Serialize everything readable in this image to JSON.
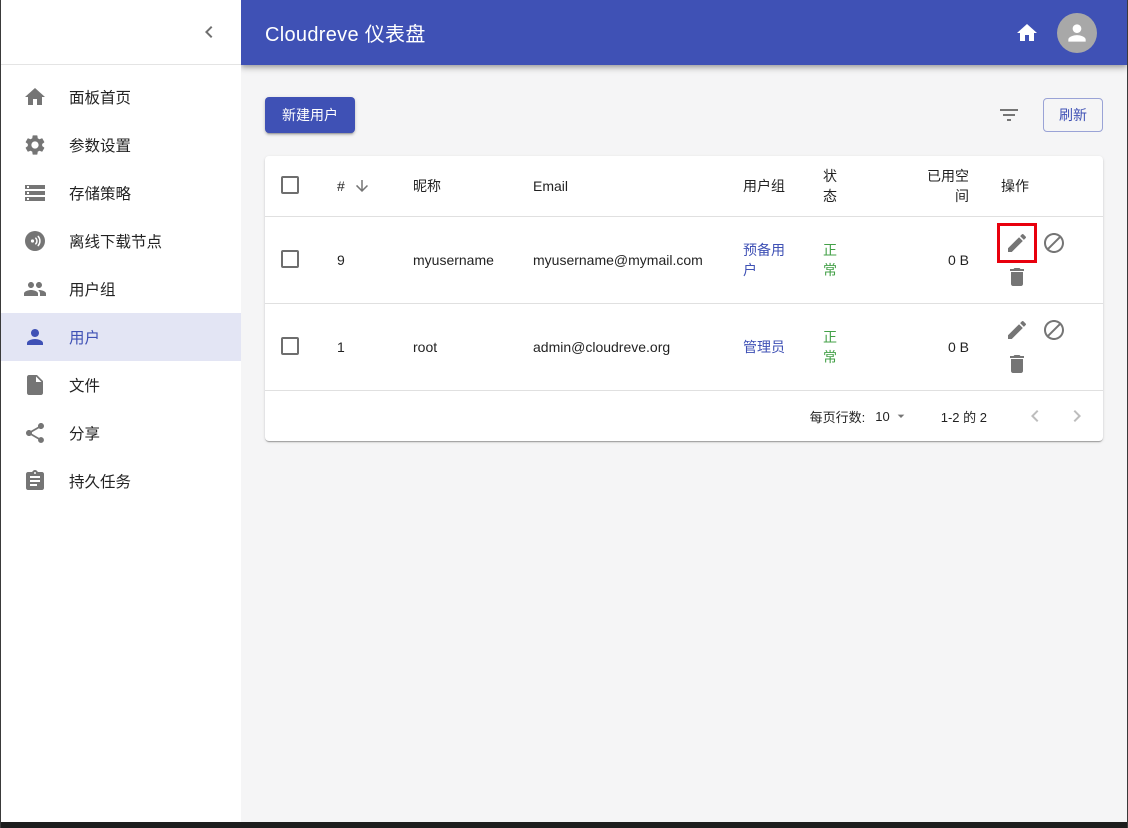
{
  "colors": {
    "primary": "#3f51b5",
    "selected_item_bg": "#e3e5f4",
    "status_ok_green": "#43a047",
    "icon_gray": "#757575",
    "highlight_red": "#e8000d",
    "content_bg": "#f5f5f6"
  },
  "app_bar": {
    "title": "Cloudreve 仪表盘",
    "icons": [
      "home-icon",
      "avatar-person-icon"
    ]
  },
  "sidebar": {
    "collapse_icon": "chevron-left-icon",
    "items": [
      {
        "label": "面板首页",
        "icon": "home-icon",
        "selected": false
      },
      {
        "label": "参数设置",
        "icon": "gear-icon",
        "selected": false
      },
      {
        "label": "存储策略",
        "icon": "storage-icon",
        "selected": false
      },
      {
        "label": "离线下载节点",
        "icon": "broadcast-node-icon",
        "selected": false
      },
      {
        "label": "用户组",
        "icon": "group-icon",
        "selected": false
      },
      {
        "label": "用户",
        "icon": "person-icon",
        "selected": true
      },
      {
        "label": "文件",
        "icon": "file-icon",
        "selected": false
      },
      {
        "label": "分享",
        "icon": "share-icon",
        "selected": false
      },
      {
        "label": "持久任务",
        "icon": "clipboard-icon",
        "selected": false
      }
    ]
  },
  "toolbar": {
    "new_user_label": "新建用户",
    "filter_icon": "filter-list-icon",
    "refresh_label": "刷新"
  },
  "table": {
    "headers": {
      "id": "#",
      "sort_icon": "arrow-down-icon",
      "nick": "昵称",
      "email": "Email",
      "group": "用户组",
      "status": "状态",
      "used": "已用空间",
      "actions": "操作"
    },
    "rows": [
      {
        "id": "9",
        "nick": "myusername",
        "email": "myusername@mymail.com",
        "group": "预备用户",
        "status": "正常",
        "used": "0 B",
        "actions": [
          "edit-icon",
          "block-icon",
          "delete-icon"
        ],
        "edit_highlighted": true
      },
      {
        "id": "1",
        "nick": "root",
        "email": "admin@cloudreve.org",
        "group": "管理员",
        "status": "正常",
        "used": "0 B",
        "actions": [
          "edit-icon",
          "block-icon",
          "delete-icon"
        ],
        "edit_highlighted": false
      }
    ]
  },
  "pagination": {
    "rows_per_page_label": "每页行数:",
    "rows_per_page_value": "10",
    "range_label": "1-2 的 2",
    "prev_icon": "chevron-left-icon",
    "next_icon": "chevron-right-icon"
  }
}
